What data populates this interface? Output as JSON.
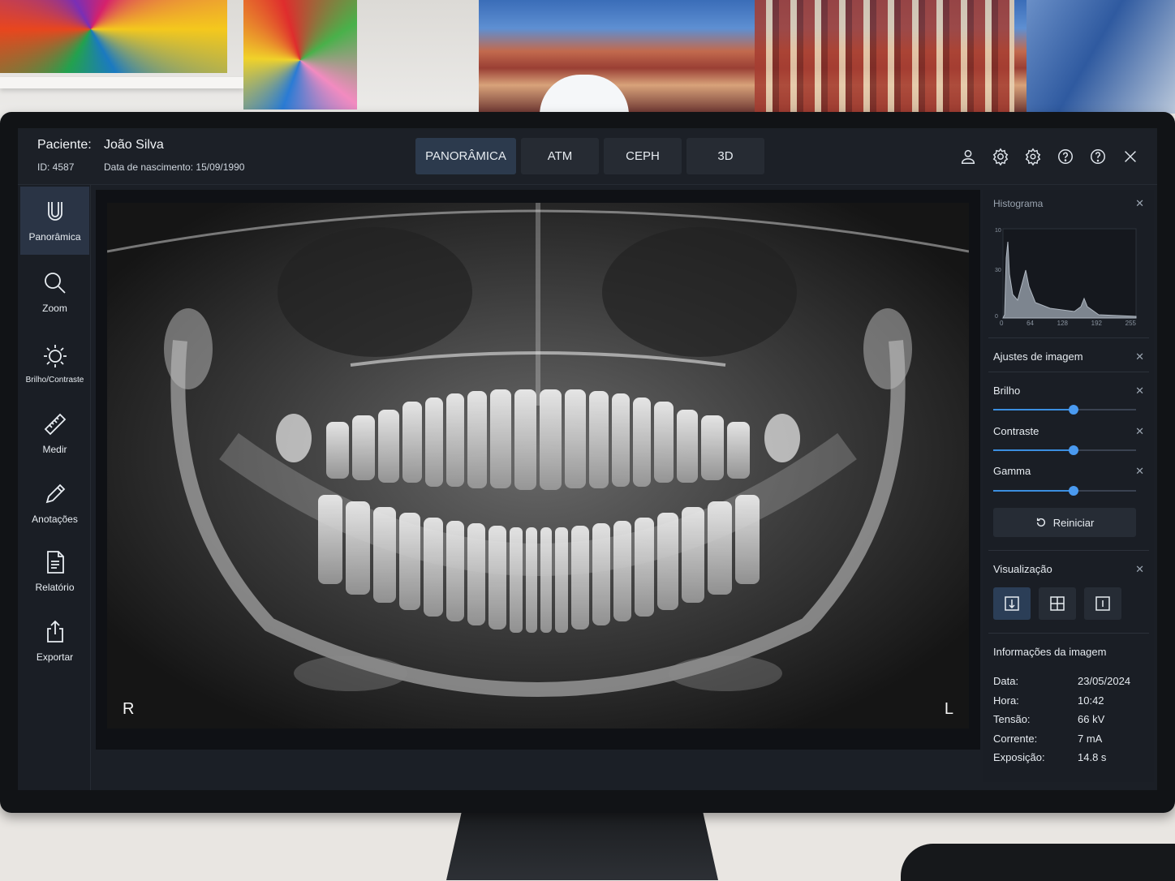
{
  "patient": {
    "label": "Paciente:",
    "name": "João Silva",
    "id": "ID: 4587",
    "dob": "Data de nascimento: 15/09/1990"
  },
  "tabs": [
    {
      "label": "PANORÂMICA",
      "active": true
    },
    {
      "label": "ATM",
      "active": false
    },
    {
      "label": "CEPH",
      "active": false
    },
    {
      "label": "3D",
      "active": false
    }
  ],
  "top_icons": [
    "user-icon",
    "settings-icon",
    "preferences-icon",
    "help-icon",
    "help-alt-icon",
    "close-icon"
  ],
  "tools": [
    {
      "label": "Panorâmica",
      "icon": "panoramic-icon",
      "active": true
    },
    {
      "label": "Zoom",
      "icon": "zoom-icon",
      "active": false
    },
    {
      "label": "Brilho/Contraste",
      "icon": "brightness-icon",
      "active": false
    },
    {
      "label": "Medir",
      "icon": "ruler-icon",
      "active": false
    },
    {
      "label": "Anotações",
      "icon": "pencil-icon",
      "active": false
    },
    {
      "label": "Relatório",
      "icon": "report-icon",
      "active": false
    },
    {
      "label": "Exportar",
      "icon": "export-icon",
      "active": false
    }
  ],
  "viewer": {
    "side_right": "R",
    "side_left": "L"
  },
  "histogram": {
    "title": "Histograma",
    "x_ticks": [
      "0",
      "64",
      "128",
      "192",
      "255"
    ],
    "y_ticks": [
      "10",
      "30",
      "0"
    ]
  },
  "adjustments": {
    "title": "Ajustes de imagem",
    "sliders": [
      {
        "label": "Brilho",
        "value": 0.56
      },
      {
        "label": "Contraste",
        "value": 0.56
      },
      {
        "label": "Gamma",
        "value": 0.56
      }
    ],
    "reset_label": "Reiniciar"
  },
  "visualization": {
    "title": "Visualização",
    "buttons": [
      "single-view-icon",
      "grid-view-icon",
      "compare-view-icon"
    ]
  },
  "image_info": {
    "title": "Informações da imagem",
    "rows": [
      {
        "label": "Data:",
        "value": "23/05/2024"
      },
      {
        "label": "Hora:",
        "value": "10:42"
      },
      {
        "label": "Tensão:",
        "value": "66 kV"
      },
      {
        "label": "Corrente:",
        "value": "7 mA"
      },
      {
        "label": "Exposição:",
        "value": "14.8 s"
      }
    ]
  },
  "colors": {
    "accent": "#3b8fe0",
    "background": "#1b1f26"
  }
}
